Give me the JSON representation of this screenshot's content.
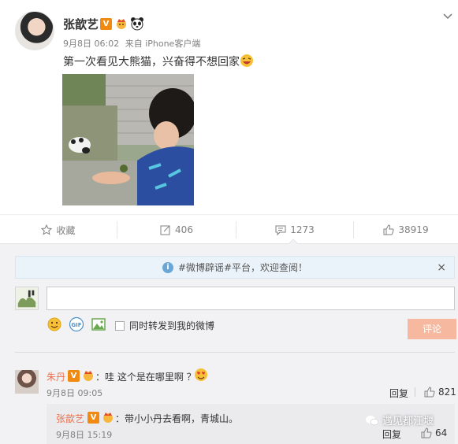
{
  "post": {
    "username": "张歆艺",
    "timestamp": "9月8日 06:02",
    "source": "来自 iPhone客户端",
    "text": "第一次看见大熊猫，兴奋得不想回家"
  },
  "actions": {
    "favorite": "收藏",
    "repost_count": "406",
    "comment_count": "1273",
    "like_count": "38919"
  },
  "comment_panel": {
    "notice": "#微博辟谣#平台，欢迎查阅！",
    "notice_close": "×",
    "input_value": "",
    "forward_label": "同时转发到我的微博",
    "submit_label": "评论"
  },
  "comments": [
    {
      "name": "朱丹",
      "text": "：哇 这个是在哪里啊 ？",
      "timestamp": "9月8日 09:05",
      "reply_label": "回复",
      "likes": "821"
    }
  ],
  "reply": {
    "name": "张歆艺",
    "text": "：带小小丹去看啊，青城山。",
    "timestamp": "9月8日 15:19",
    "reply_label": "回复",
    "likes": "64"
  },
  "watermark": "遇见都江堰",
  "colors": {
    "accent": "#eb7350",
    "badge": "#f08a12",
    "submit": "#f7b8a0"
  }
}
